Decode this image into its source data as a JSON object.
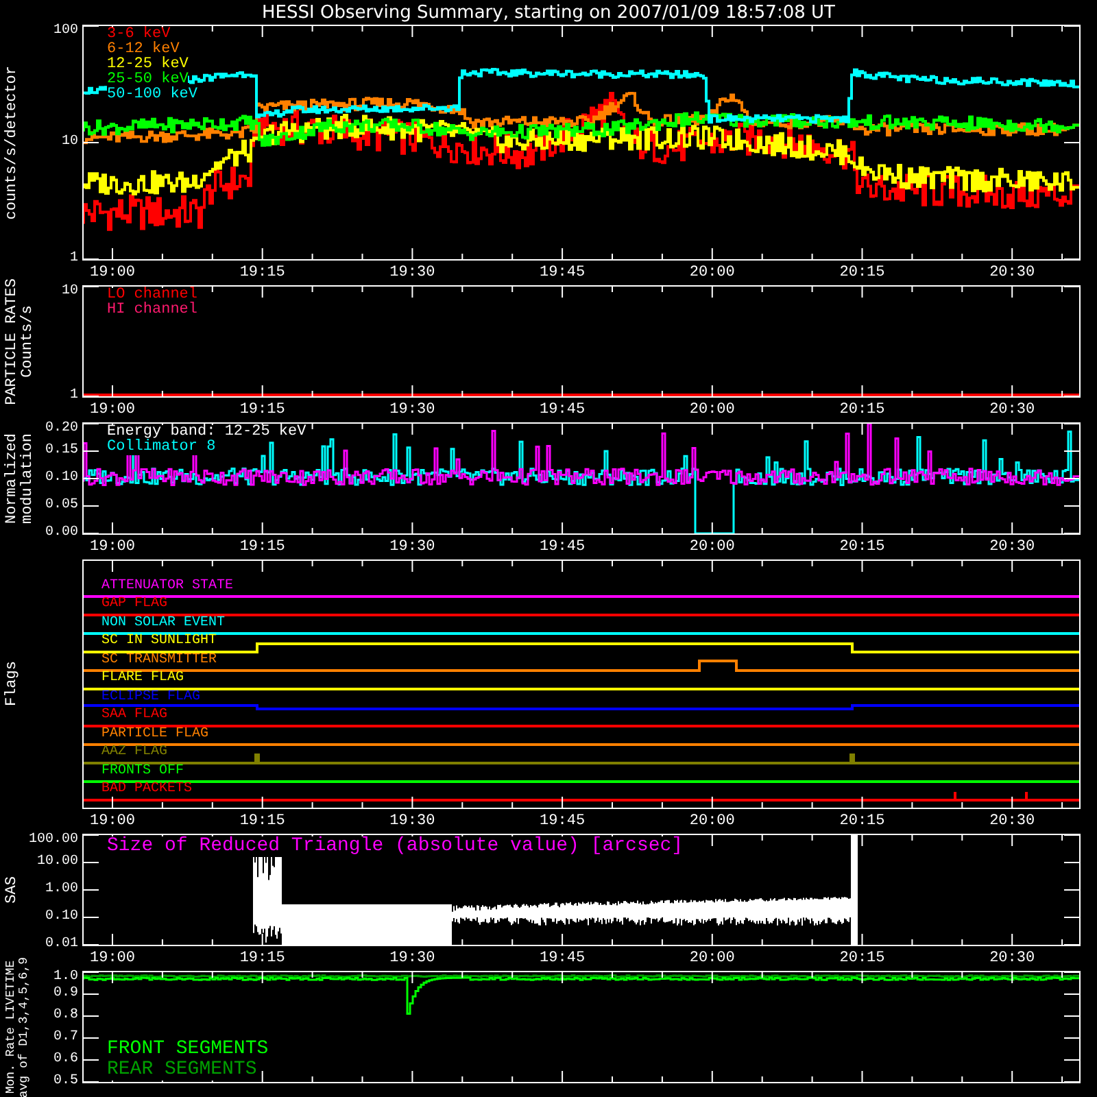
{
  "title": "HESSI Observing Summary, starting on 2007/01/09 18:57:08 UT",
  "panels": [
    {
      "kind": "counts",
      "ylabel": [
        "counts/s/detector"
      ],
      "yticks": [
        "100",
        "10",
        "1"
      ],
      "legend": [
        {
          "label": "3-6 keV",
          "color": "#ff0000"
        },
        {
          "label": "6-12 keV",
          "color": "#ff8000"
        },
        {
          "label": "12-25 keV",
          "color": "#ffff00"
        },
        {
          "label": "25-50 keV",
          "color": "#00ff00"
        },
        {
          "label": "50-100 keV",
          "color": "#00ffff"
        }
      ],
      "xticks": [
        "19:00",
        "19:15",
        "19:30",
        "19:45",
        "20:00",
        "20:15",
        "20:30"
      ]
    },
    {
      "kind": "particles",
      "ylabel": [
        "PARTICLE RATES",
        "Counts/s"
      ],
      "yticks": [
        "10",
        "1"
      ],
      "legend": [
        {
          "label": "LO channel",
          "color": "#ff0000"
        },
        {
          "label": "HI channel",
          "color": "#ff1a6e"
        }
      ],
      "xticks": [
        "19:00",
        "19:15",
        "19:30",
        "19:45",
        "20:00",
        "20:15",
        "20:30"
      ]
    },
    {
      "kind": "modulation",
      "ylabel": [
        "Normalized",
        "modulation"
      ],
      "yticks": [
        "0.20",
        "0.15",
        "0.10",
        "0.05",
        "0.00"
      ],
      "legend": [
        {
          "label": "Energy band: 12-25 keV",
          "color": "#ffffff"
        },
        {
          "label": "Collimator 8",
          "color": "#00ffff"
        }
      ],
      "xticks": [
        "19:00",
        "19:15",
        "19:30",
        "19:45",
        "20:00",
        "20:15",
        "20:30"
      ]
    },
    {
      "kind": "flags",
      "ylabel": [
        "Flags"
      ],
      "flags": [
        {
          "label": "ATTENUATOR STATE",
          "color": "#ff00ff"
        },
        {
          "label": "GAP FLAG",
          "color": "#ff0000"
        },
        {
          "label": "NON SOLAR EVENT",
          "color": "#00ffff"
        },
        {
          "label": "SC IN SUNLIGHT",
          "color": "#ffff00"
        },
        {
          "label": "SC TRANSMITTER",
          "color": "#ff8000"
        },
        {
          "label": "FLARE FLAG",
          "color": "#ffff00"
        },
        {
          "label": "ECLIPSE FLAG",
          "color": "#0000ff"
        },
        {
          "label": "SAA FLAG",
          "color": "#ff0000"
        },
        {
          "label": "PARTICLE FLAG",
          "color": "#ff8000"
        },
        {
          "label": "AAZ FLAG",
          "color": "#808000"
        },
        {
          "label": "FRONTS OFF",
          "color": "#00ff00"
        },
        {
          "label": "BAD PACKETS",
          "color": "#ff0000"
        }
      ],
      "xticks": [
        "19:00",
        "19:15",
        "19:30",
        "19:45",
        "20:00",
        "20:15",
        "20:30"
      ]
    },
    {
      "kind": "sas",
      "ylabel": [
        "SAS"
      ],
      "yticks": [
        "100.00",
        "10.00",
        "1.00",
        "0.10",
        "0.01"
      ],
      "legend": [
        {
          "label": "Size of Reduced Triangle (absolute value) [arcsec]",
          "color": "#ff00ff"
        }
      ],
      "xticks": [
        "19:00",
        "19:15",
        "19:30",
        "19:45",
        "20:00",
        "20:15",
        "20:30"
      ]
    },
    {
      "kind": "livetime",
      "ylabel": [
        "Mon. Rate LIVETIME",
        "avg of D1,3,4,5,6,9"
      ],
      "yticks": [
        "1.0",
        "0.9",
        "0.8",
        "0.7",
        "0.6",
        "0.5"
      ],
      "legend": [
        {
          "label": "FRONT SEGMENTS",
          "color": "#00ff00"
        },
        {
          "label": "REAR SEGMENTS",
          "color": "#00a000"
        }
      ]
    }
  ]
}
